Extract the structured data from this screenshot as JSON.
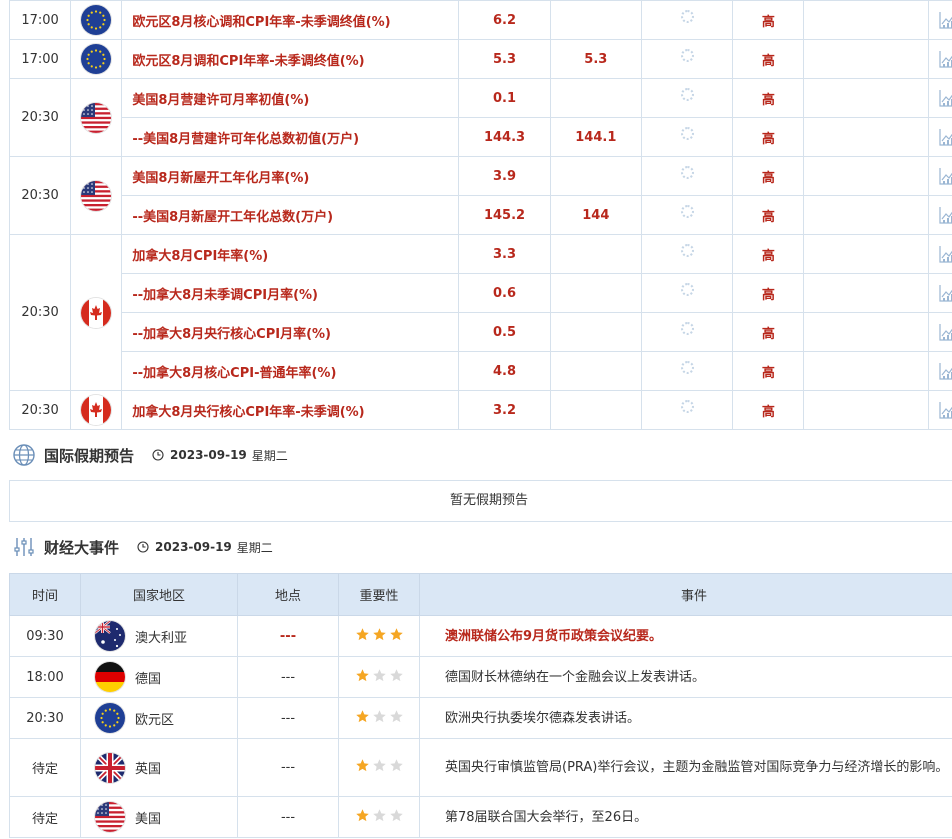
{
  "calendar_rows": [
    {
      "time": "17:00",
      "flag": "eu",
      "items": [
        {
          "name": "欧元区8月核心调和CPI年率-未季调终值(%)",
          "prev": "6.2",
          "forecast": "",
          "importance": "高"
        }
      ]
    },
    {
      "time": "17:00",
      "flag": "eu",
      "items": [
        {
          "name": "欧元区8月调和CPI年率-未季调终值(%)",
          "prev": "5.3",
          "forecast": "5.3",
          "importance": "高"
        }
      ]
    },
    {
      "time": "20:30",
      "flag": "us",
      "items": [
        {
          "name": "美国8月营建许可月率初值(%)",
          "prev": "0.1",
          "forecast": "",
          "importance": "高"
        },
        {
          "name": "--美国8月营建许可年化总数初值(万户)",
          "prev": "144.3",
          "forecast": "144.1",
          "importance": "高"
        }
      ]
    },
    {
      "time": "20:30",
      "flag": "us",
      "items": [
        {
          "name": "美国8月新屋开工年化月率(%)",
          "prev": "3.9",
          "forecast": "",
          "importance": "高"
        },
        {
          "name": "--美国8月新屋开工年化总数(万户)",
          "prev": "145.2",
          "forecast": "144",
          "importance": "高"
        }
      ]
    },
    {
      "time": "20:30",
      "flag": "ca",
      "items": [
        {
          "name": "加拿大8月CPI年率(%)",
          "prev": "3.3",
          "forecast": "",
          "importance": "高"
        },
        {
          "name": "--加拿大8月未季调CPI月率(%)",
          "prev": "0.6",
          "forecast": "",
          "importance": "高"
        },
        {
          "name": "--加拿大8月央行核心CPI月率(%)",
          "prev": "0.5",
          "forecast": "",
          "importance": "高"
        },
        {
          "name": "--加拿大8月核心CPI-普通年率(%)",
          "prev": "4.8",
          "forecast": "",
          "importance": "高"
        }
      ]
    },
    {
      "time": "20:30",
      "flag": "ca",
      "items": [
        {
          "name": "加拿大8月央行核心CPI年率-未季调(%)",
          "prev": "3.2",
          "forecast": "",
          "importance": "高"
        }
      ]
    }
  ],
  "holiday": {
    "title": "国际假期预告",
    "date": "2023-09-19",
    "weekday": "星期二",
    "empty_text": "暂无假期预告"
  },
  "events": {
    "title": "财经大事件",
    "date": "2023-09-19",
    "weekday": "星期二",
    "headers": {
      "time": "时间",
      "country": "国家地区",
      "place": "地点",
      "importance": "重要性",
      "event": "事件"
    },
    "rows": [
      {
        "time": "09:30",
        "flag": "au",
        "country": "澳大利亚",
        "place": "---",
        "stars": 3,
        "event": "澳洲联储公布9月货币政策会议纪要。",
        "highlight": true
      },
      {
        "time": "18:00",
        "flag": "de",
        "country": "德国",
        "place": "---",
        "stars": 1,
        "event": "德国财长林德纳在一个金融会议上发表讲话。",
        "highlight": false
      },
      {
        "time": "20:30",
        "flag": "eu",
        "country": "欧元区",
        "place": "---",
        "stars": 1,
        "event": "欧洲央行执委埃尔德森发表讲话。",
        "highlight": false
      },
      {
        "time": "待定",
        "flag": "gb",
        "country": "英国",
        "place": "---",
        "stars": 1,
        "event": "英国央行审慎监管局(PRA)举行会议，主题为金融监管对国际竞争力与经济增长的影响。",
        "highlight": false
      },
      {
        "time": "待定",
        "flag": "us",
        "country": "美国",
        "place": "---",
        "stars": 1,
        "event": "第78届联合国大会举行，至26日。",
        "highlight": false
      }
    ]
  },
  "colors": {
    "accent_red": "#b8281c",
    "header_blue": "#dae7f5",
    "border": "#d6e1ec",
    "star": "#f5a623"
  }
}
